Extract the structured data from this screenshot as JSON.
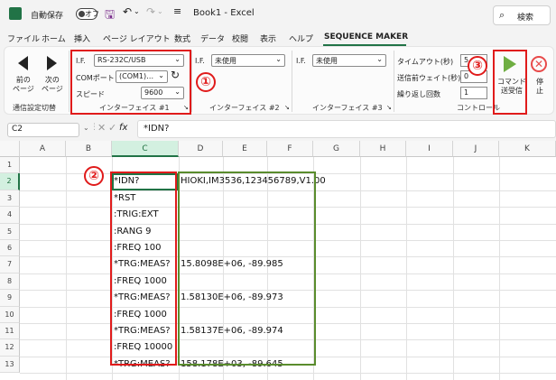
{
  "titlebar": {
    "autosave_label": "自動保存",
    "autosave_state": "オフ",
    "workbook_title": "Book1 - Excel",
    "search_label": "検索"
  },
  "menu": {
    "tabs": [
      "ファイル",
      "ホーム",
      "挿入",
      "ページ レイアウト",
      "数式",
      "データ",
      "校閲",
      "表示",
      "ヘルプ",
      "SEQUENCE MAKER"
    ]
  },
  "ribbon": {
    "nav": {
      "prev_label": "前の\nページ",
      "next_label": "次の\nページ",
      "group_label": "通信設定切替"
    },
    "if1": {
      "if_label": "I.F.",
      "if_value": "RS-232C/USB",
      "com_label": "COMポート",
      "com_value": "(COM1)…",
      "speed_label": "スピード",
      "speed_value": "9600",
      "group_label": "インターフェイス #1"
    },
    "if2": {
      "if_label": "I.F.",
      "if_value": "未使用",
      "group_label": "インターフェイス #2"
    },
    "if3": {
      "if_label": "I.F.",
      "if_value": "未使用",
      "group_label": "インターフェイス #3"
    },
    "control": {
      "timeout_label": "タイムアウト(秒)",
      "timeout_value": "5",
      "wait_label": "送信前ウェイト(秒)",
      "wait_value": "0",
      "repeat_label": "繰り返し回数",
      "repeat_value": "1",
      "group_label": "コントロール"
    },
    "send_label": "コマンド\n送受信",
    "stop_label": "停\n止"
  },
  "annotations": [
    "①",
    "②",
    "③"
  ],
  "formula_bar": {
    "name_box": "C2",
    "fx": "fx",
    "content": "*IDN?"
  },
  "sheet": {
    "columns": [
      "A",
      "B",
      "C",
      "D",
      "E",
      "F",
      "G",
      "H",
      "I",
      "J",
      "K"
    ],
    "rows": [
      "1",
      "2",
      "3",
      "4",
      "5",
      "6",
      "7",
      "8",
      "9",
      "10",
      "11",
      "12",
      "13"
    ],
    "commands": [
      "*IDN?",
      "*RST",
      ":TRIG:EXT",
      ":RANG 9",
      ":FREQ 100",
      "*TRG:MEAS?",
      ":FREQ 1000",
      "*TRG:MEAS?",
      ":FREQ 1000",
      "*TRG:MEAS?",
      ":FREQ 10000",
      "*TRG:MEAS?"
    ],
    "responses": [
      "HIOKI,IM3536,123456789,V1.00",
      "",
      "",
      "",
      "",
      "15.8098E+06, -89.985",
      "",
      "1.58130E+06, -89.973",
      "",
      "1.58137E+06, -89.974",
      "",
      "158.178E+03, -89.645"
    ]
  },
  "colors": {
    "accent": "#217346",
    "annotation_red": "#e01b1b",
    "annotation_green": "#5a8c2d"
  }
}
